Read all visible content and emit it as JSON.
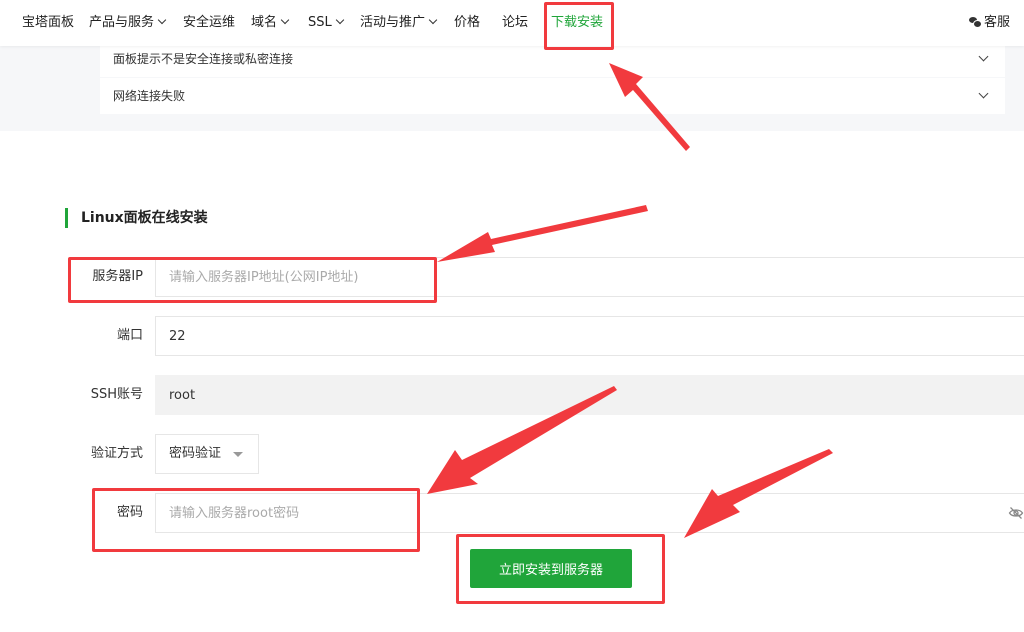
{
  "nav": {
    "items": [
      {
        "label": "宝塔面板",
        "dropdown": false
      },
      {
        "label": "产品与服务",
        "dropdown": true
      },
      {
        "label": "安全运维",
        "dropdown": false
      },
      {
        "label": "域名",
        "dropdown": true
      },
      {
        "label": "SSL",
        "dropdown": true
      },
      {
        "label": "活动与推广",
        "dropdown": true
      },
      {
        "label": "价格",
        "dropdown": false
      },
      {
        "label": "论坛",
        "dropdown": false
      },
      {
        "label": "下载安装",
        "dropdown": false,
        "active": true
      }
    ],
    "support_label": "客服",
    "active_color": "#20a53a"
  },
  "faq": {
    "items": [
      {
        "label": "面板提示不是安全连接或私密连接"
      },
      {
        "label": "网络连接失败"
      }
    ]
  },
  "install": {
    "title": "Linux面板在线安装",
    "server_ip": {
      "label": "服务器IP",
      "value": "",
      "placeholder": "请输入服务器IP地址(公网IP地址)"
    },
    "port": {
      "label": "端口",
      "value": "22"
    },
    "ssh_account": {
      "label": "SSH账号",
      "value": "root"
    },
    "auth_method": {
      "label": "验证方式",
      "value": "密码验证"
    },
    "password": {
      "label": "密码",
      "value": "",
      "placeholder": "请输入服务器root密码"
    },
    "submit_label": "立即安装到服务器"
  },
  "colors": {
    "accent": "#20a53a",
    "annotation": "#f13a3e"
  },
  "icons": {
    "support": "wechat-icon",
    "password_toggle": "eye-slash-icon",
    "select": "caret-down-icon",
    "faq_expand": "chevron-down-icon"
  }
}
